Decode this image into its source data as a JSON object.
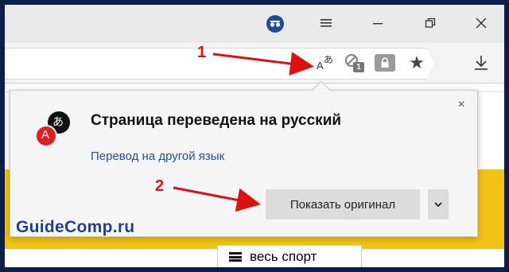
{
  "browser": {
    "incognito_icon": "incognito-mask-icon",
    "menu_icon": "hamburger-icon",
    "minimize_icon": "restore-icon",
    "close_icon": "close-icon",
    "translate_icon_glyph_latin": "A",
    "translate_icon_glyph_cjk": "あ",
    "blocked_count": "1",
    "star_glyph": "★"
  },
  "popup": {
    "title": "Страница переведена на русский",
    "link": "Перевод на другой язык",
    "show_original_label": "Показать оригинал",
    "close_glyph": "×",
    "logo_glyph_latin": "A",
    "logo_glyph_cjk": "あ"
  },
  "page": {
    "tab_label": "весь спорт"
  },
  "annotations": {
    "step1": "1",
    "step2": "2",
    "color": "#dd1111"
  },
  "watermark": "GuideComp.ru",
  "colors": {
    "accent_blue": "#1c4fb8",
    "yellow": "#f2c312",
    "logo_red": "#e02020"
  }
}
